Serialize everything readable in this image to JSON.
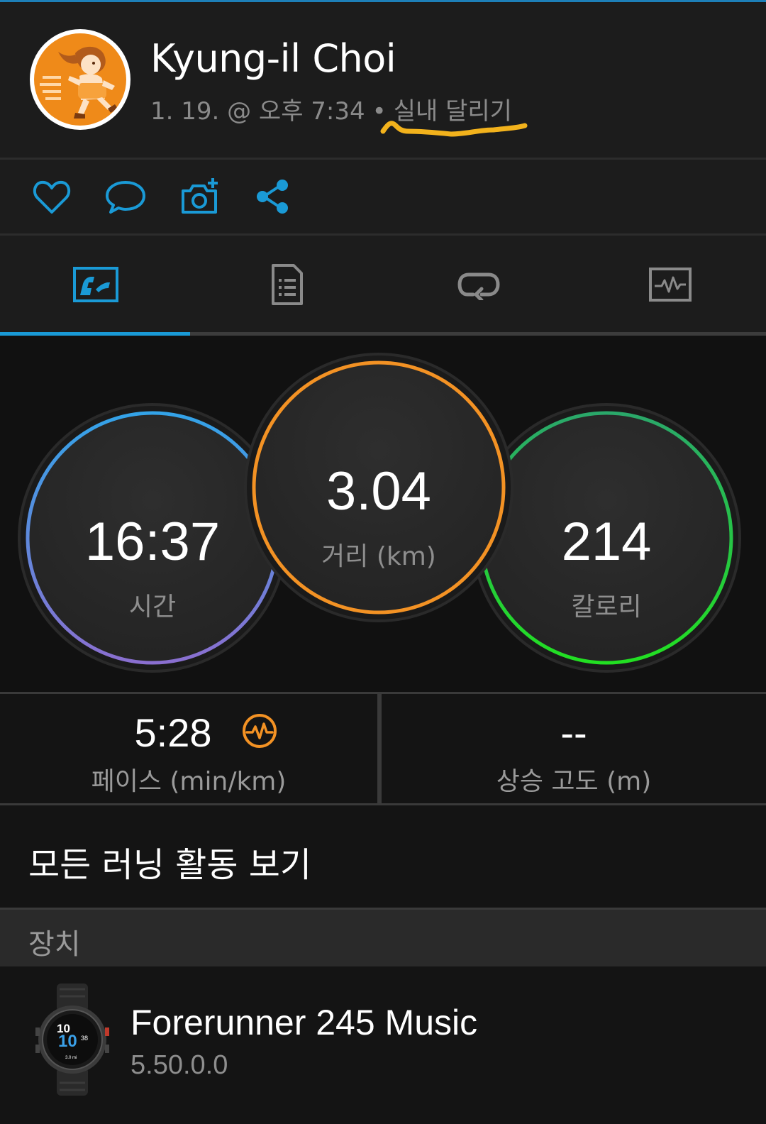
{
  "header": {
    "user_name": "Kyung-il Choi",
    "date_time": "1. 19. @ 오후 7:34",
    "dot": "•",
    "activity_type": "실내 달리기"
  },
  "actions": [
    "heart-icon",
    "comment-icon",
    "add-photo-icon",
    "share-icon"
  ],
  "tabs": [
    "stats-tab-icon",
    "details-tab-icon",
    "laps-tab-icon",
    "charts-tab-icon"
  ],
  "active_tab": 0,
  "stats": {
    "time": {
      "value": "16:37",
      "label": "시간",
      "color": "#3a9fe0"
    },
    "distance": {
      "value": "3.04",
      "label": "거리 (km)",
      "color": "#f39224"
    },
    "calories": {
      "value": "214",
      "label": "칼로리",
      "color": "#2cd63a"
    }
  },
  "pace": {
    "value": "5:28",
    "label": "페이스 (min/km)",
    "icon": "pace-chart-icon",
    "icon_color": "#f39224"
  },
  "elevation": {
    "value": "--",
    "label": "상승 고도 (m)"
  },
  "view_all": "모든 러닝 활동 보기",
  "section_title": "장치",
  "device": {
    "name": "Forerunner 245 Music",
    "version": "5.50.0.0",
    "watch_face": {
      "hour": "10",
      "minute": "10",
      "seconds": "38",
      "distance": "3.0 mi"
    }
  },
  "colors": {
    "accent": "#1a9ad6",
    "panel": "#1c1c1c",
    "background": "#111111"
  }
}
